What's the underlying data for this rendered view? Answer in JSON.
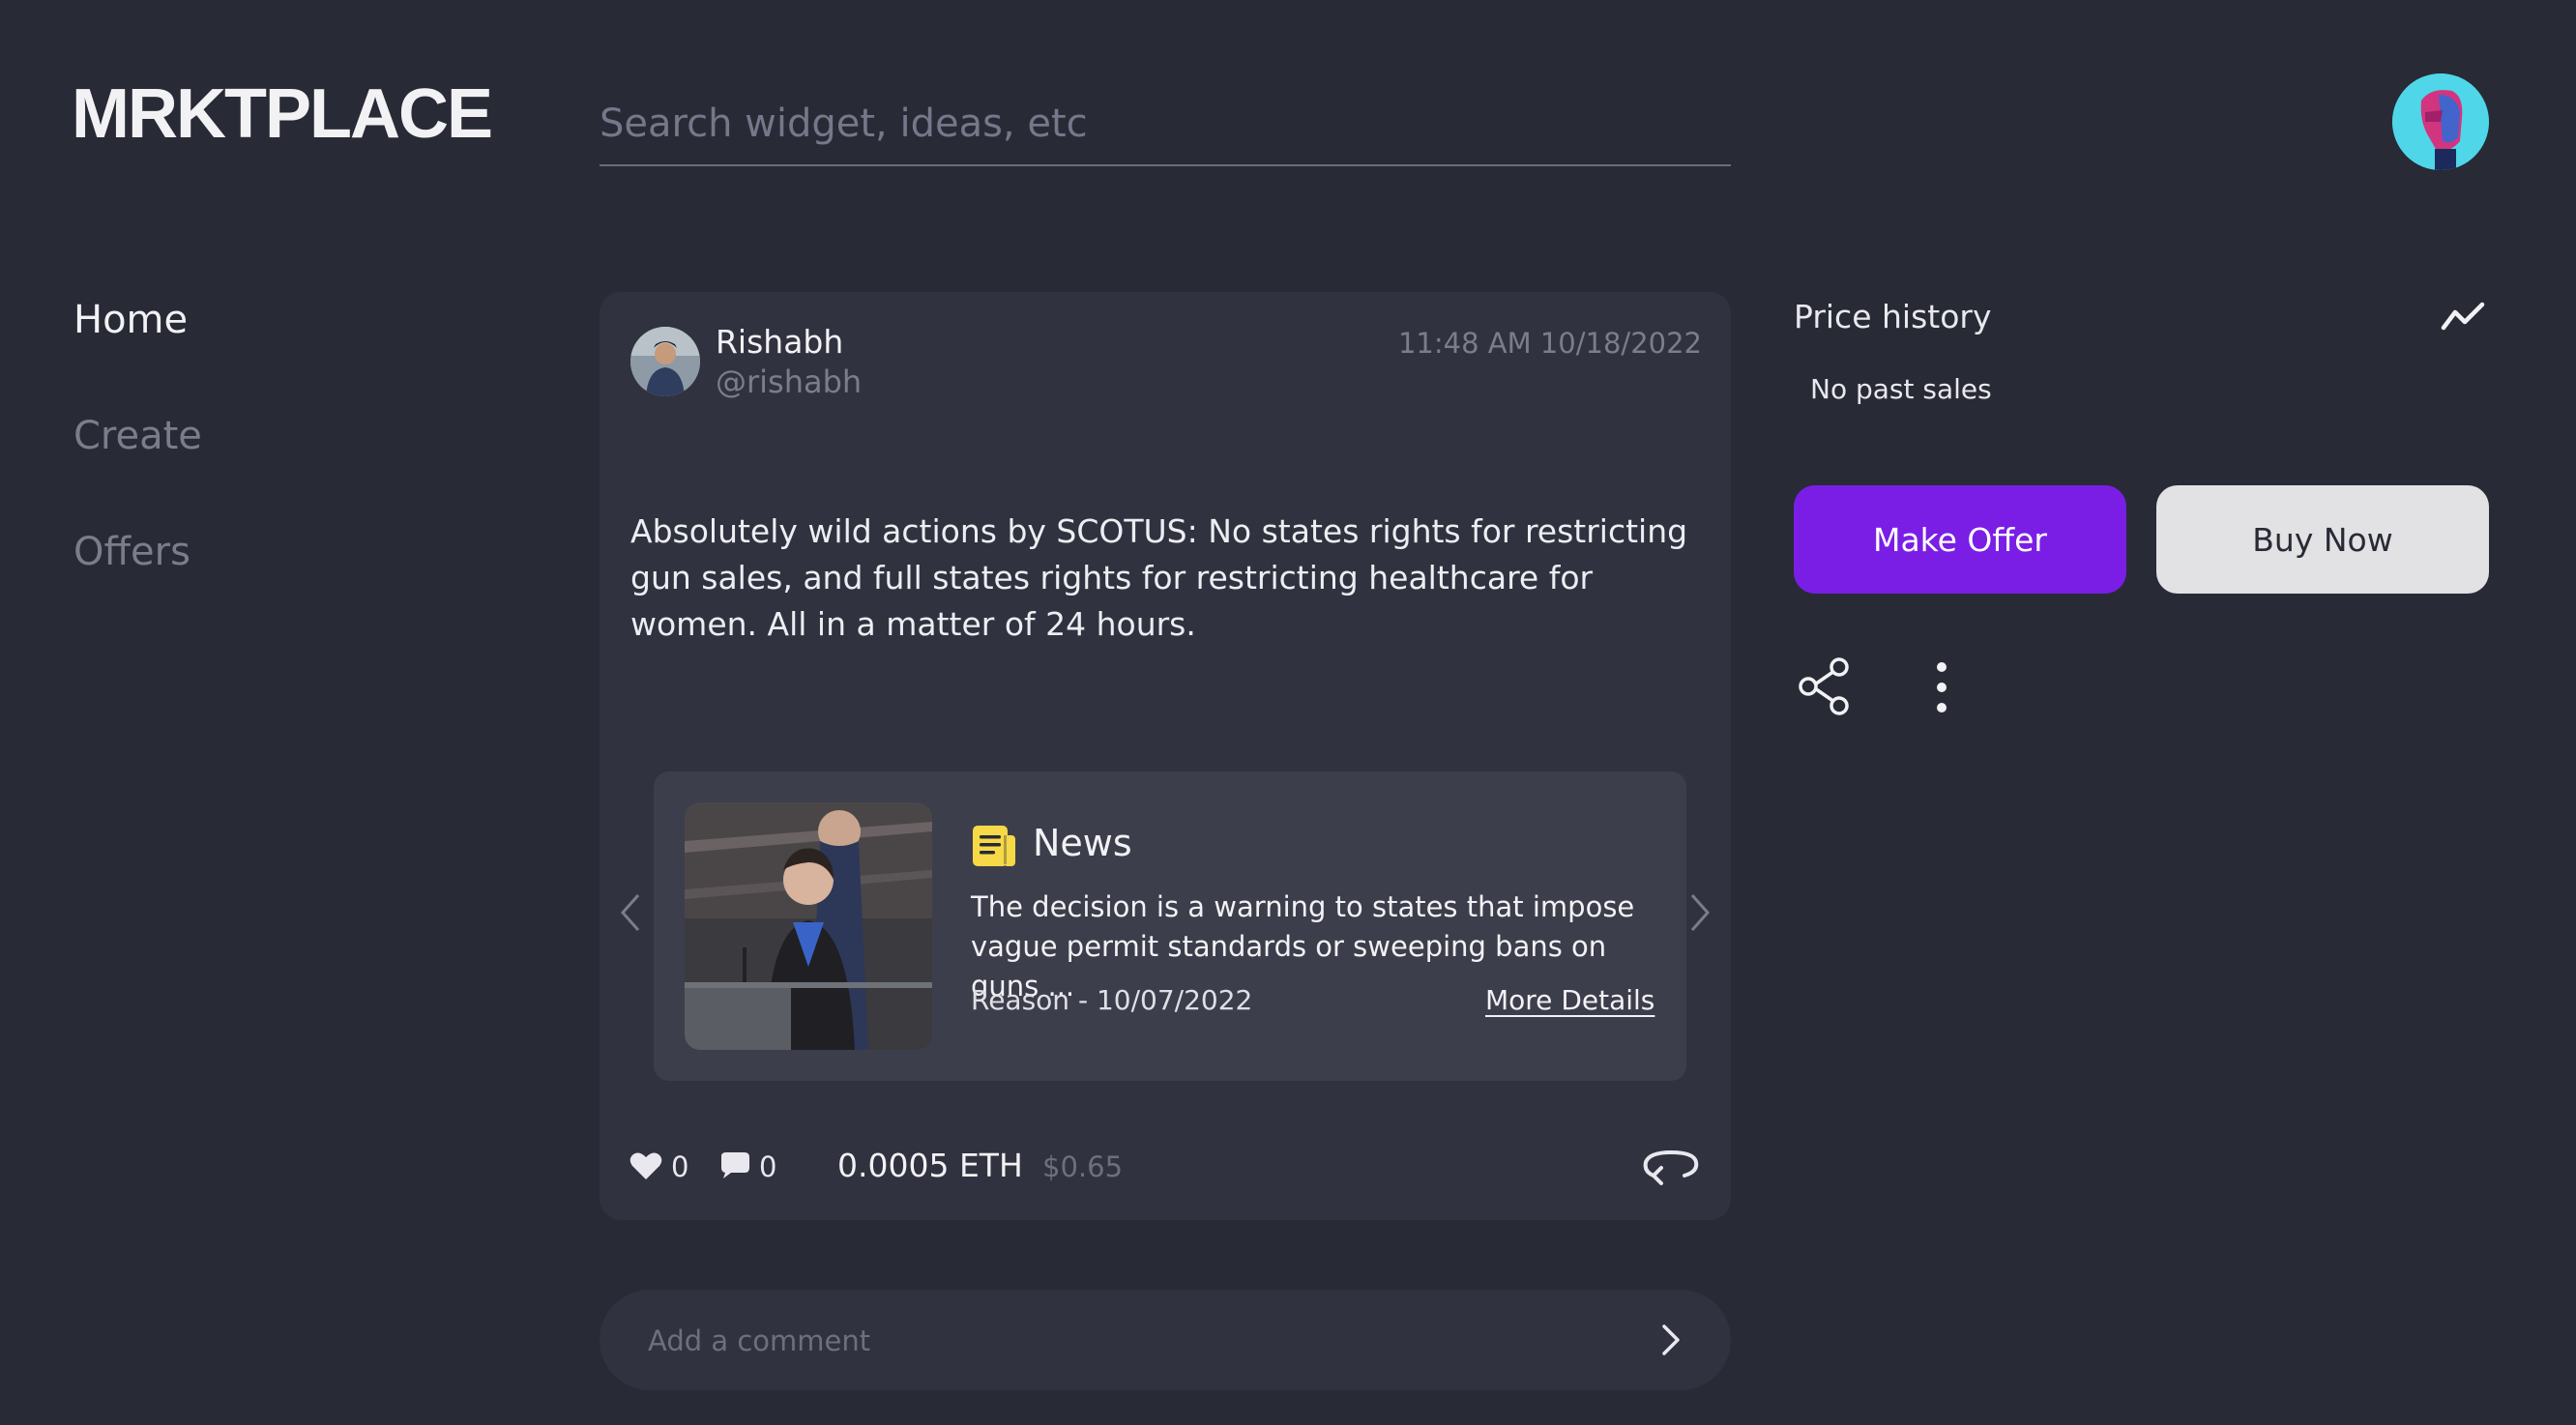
{
  "app": {
    "logo": "MRKTPLACE"
  },
  "search": {
    "placeholder": "Search widget, ideas, etc"
  },
  "nav": {
    "items": [
      {
        "label": "Home",
        "active": true
      },
      {
        "label": "Create",
        "active": false
      },
      {
        "label": "Offers",
        "active": false
      }
    ]
  },
  "post": {
    "author_name": "Rishabh",
    "author_handle": "@rishabh",
    "timestamp": "11:48 AM 10/18/2022",
    "text": "Absolutely wild actions by SCOTUS: No states rights for restricting gun sales, and full states rights for restricting healthcare for women. All in a matter of 24 hours.",
    "news": {
      "label": "News",
      "icon": "newspaper-icon",
      "summary": "The decision is a warning to states that impose vague permit standards or sweeping bans on guns ...",
      "source": "Reason - 10/07/2022",
      "more_label": "More Details"
    },
    "likes": "0",
    "comments": "0",
    "price_eth": "0.0005 ETH",
    "price_usd": "$0.65"
  },
  "comment": {
    "placeholder": "Add a comment"
  },
  "price_history": {
    "title": "Price history",
    "empty_text": "No past sales"
  },
  "actions": {
    "make_offer": "Make Offer",
    "buy_now": "Buy Now"
  },
  "colors": {
    "background": "#282a35",
    "card": "#31323f",
    "accent": "#7a1ee6",
    "news_icon": "#f7d948"
  }
}
